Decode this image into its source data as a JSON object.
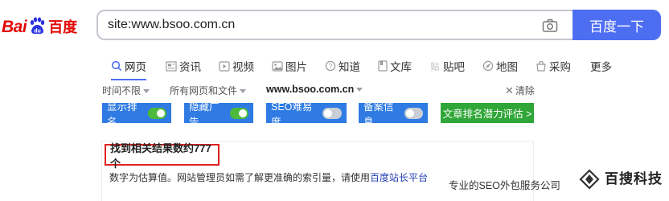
{
  "logo": {
    "text_latin_1": "Bai",
    "text_latin_2": "du",
    "text_cn": "百度"
  },
  "search": {
    "query": "site:www.bsoo.com.cn",
    "button_label": "百度一下"
  },
  "tabs": [
    {
      "label": "网页",
      "icon": "search-icon"
    },
    {
      "label": "资讯",
      "icon": "news-icon"
    },
    {
      "label": "视频",
      "icon": "video-icon"
    },
    {
      "label": "图片",
      "icon": "image-icon"
    },
    {
      "label": "知道",
      "icon": "question-icon"
    },
    {
      "label": "文库",
      "icon": "doc-icon"
    },
    {
      "label": "贴吧",
      "icon": "tieba-icon"
    },
    {
      "label": "地图",
      "icon": "map-icon"
    },
    {
      "label": "采购",
      "icon": "bag-icon"
    },
    {
      "label": "更多"
    }
  ],
  "filters": {
    "time": "时间不限",
    "type": "所有网页和文件",
    "site": "www.bsoo.com.cn",
    "clear": "清除"
  },
  "tags": [
    {
      "label": "显示排名",
      "toggle": "on"
    },
    {
      "label": "隐藏广告",
      "toggle": "on"
    },
    {
      "label": "SEO难易度",
      "toggle": "off"
    },
    {
      "label": "备案信息",
      "toggle": "off"
    }
  ],
  "green_button": "文章排名潜力评估 >",
  "results": {
    "count_text": "找到相关结果数约777个",
    "note_prefix": "数字为估算值。网站管理员如需了解更准确的索引量，请使用",
    "note_link": "百度站长平台"
  },
  "watermark": {
    "text": "专业的SEO外包服务公司",
    "brand": "百搜科技"
  },
  "colors": {
    "accent": "#4e6ef2",
    "tag_blue": "#2f7be3",
    "tag_green": "#2fa637",
    "toggle_on": "#4cbb3c",
    "highlight_red": "#e02020",
    "logo_red": "#e10602",
    "logo_blue": "#2932e1"
  }
}
